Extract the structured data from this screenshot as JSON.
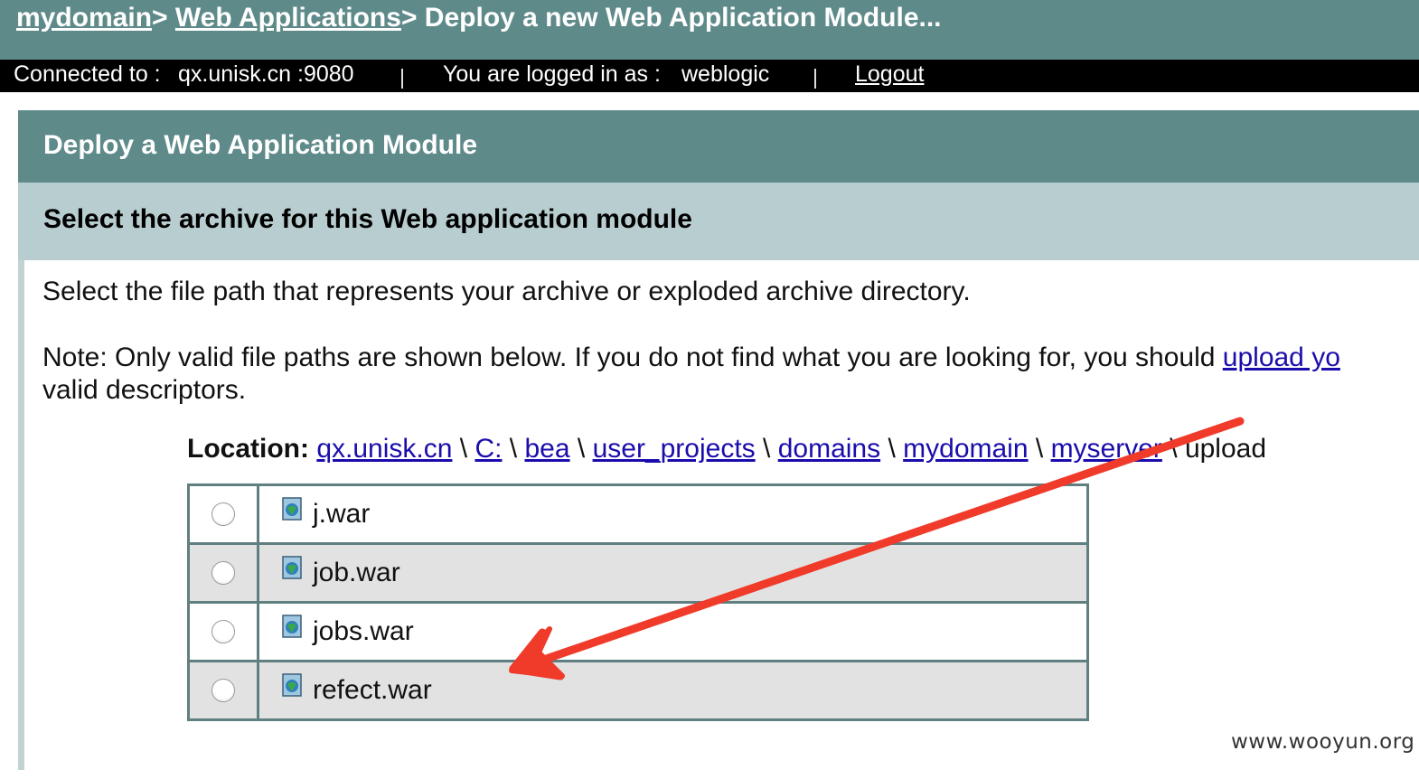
{
  "breadcrumb": {
    "domain_link": "mydomain",
    "sep1": ">",
    "webapps_link": "Web Applications",
    "sep2": ">",
    "current": " Deploy a new Web Application Module..."
  },
  "status_bar": {
    "connected_label": "Connected to :",
    "connected_value": "qx.unisk.cn :9080",
    "logged_label": "You are logged in as :",
    "logged_value": "weblogic",
    "logout_label": "Logout"
  },
  "panel": {
    "title": "Deploy a Web Application Module",
    "subtitle": "Select the archive for this Web application module",
    "intro": "Select the file path that represents your archive or exploded archive directory.",
    "note_prefix": "Note: Only valid file paths are shown below. If you do not find what you are looking for, you should ",
    "note_link": "upload yo",
    "note_suffix": "valid descriptors."
  },
  "location": {
    "label": "Location:",
    "segments": [
      "qx.unisk.cn",
      "C:",
      "bea",
      "user_projects",
      "domains",
      "mydomain",
      "myserver"
    ],
    "separator": "\\",
    "current": "upload"
  },
  "files": [
    {
      "name": "j.war",
      "selected": false
    },
    {
      "name": "job.war",
      "selected": false
    },
    {
      "name": "jobs.war",
      "selected": false
    },
    {
      "name": "refect.war",
      "selected": false
    }
  ],
  "annotation": {
    "arrow_color": "#f03a2a",
    "icon_name": "arrow-annotation"
  },
  "watermark": "www.wooyun.org",
  "colors": {
    "header": "#5f8a8a",
    "subheader": "#b8cdcf",
    "status_bar": "#000000",
    "alt_row": "#e2e2e2"
  }
}
